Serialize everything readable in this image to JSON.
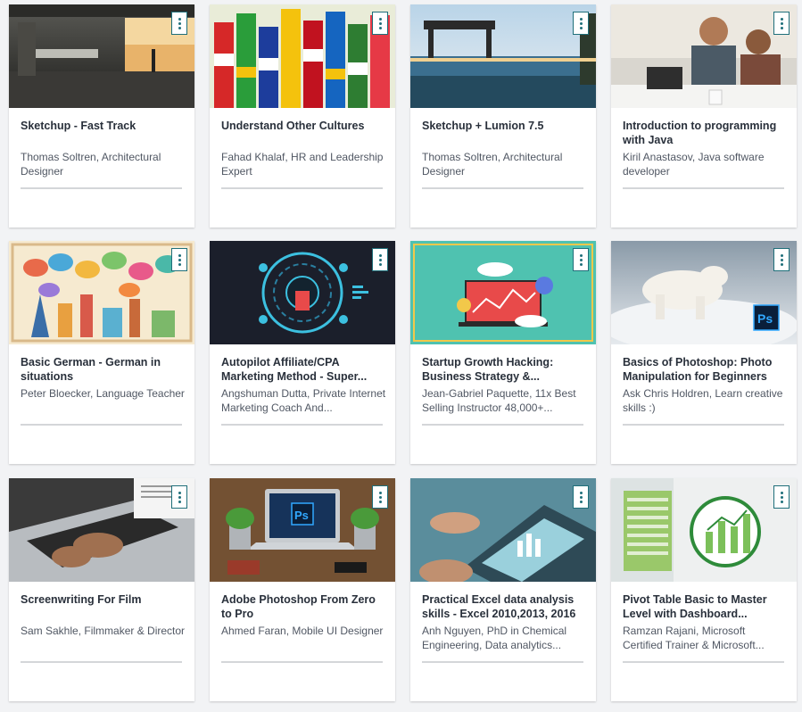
{
  "courses": [
    {
      "title": "Sketchup - Fast Track",
      "author": "Thomas Soltren, Architectural Designer",
      "image": "dark-interior",
      "progress": 0
    },
    {
      "title": "Understand Other Cultures",
      "author": "Fahad Khalaf, HR and Leadership Expert",
      "image": "flag-people",
      "progress": 0
    },
    {
      "title": "Sketchup + Lumion 7.5",
      "author": "Thomas Soltren, Architectural Designer",
      "image": "pool-villa",
      "progress": 0
    },
    {
      "title": "Introduction to programming with Java",
      "author": "Kiril Anastasov, Java software developer",
      "image": "office-people",
      "progress": 0
    },
    {
      "title": "Basic German - German in situations",
      "author": "Peter Bloecker, Language Teacher",
      "image": "landmarks-speech",
      "progress": 0
    },
    {
      "title": "Autopilot Affiliate/CPA Marketing Method - Super...",
      "author": "Angshuman Dutta, Private Internet Marketing Coach And...",
      "image": "tech-circle",
      "progress": 0
    },
    {
      "title": "Startup Growth Hacking: Business Strategy &...",
      "author": "Jean-Gabriel Paquette, 11x Best Selling Instructor 48,000+...",
      "image": "teal-laptop",
      "progress": 0
    },
    {
      "title": "Basics of Photoshop: Photo Manipulation for Beginners",
      "author": "Ask Chris Holdren, Learn creative skills :)",
      "image": "polar-bear",
      "progress": 0
    },
    {
      "title": "Screenwriting For Film",
      "author": "Sam Sakhle, Filmmaker & Director",
      "image": "typing-laptop",
      "progress": 0
    },
    {
      "title": "Adobe Photoshop From Zero to Pro",
      "author": "Ahmed Faran, Mobile UI Designer",
      "image": "desk-photoshop",
      "progress": 0
    },
    {
      "title": "Practical Excel data analysis skills - Excel 2010,2013, 2016",
      "author": "Anh Nguyen, PhD in Chemical Engineering, Data analytics...",
      "image": "tablet-hands",
      "progress": 0
    },
    {
      "title": "Pivot Table Basic to Master Level with Dashboard...",
      "author": "Ramzan Rajani, Microsoft Certified Trainer & Microsoft...",
      "image": "excel-chart",
      "progress": 0
    }
  ],
  "colors": {
    "accent": "#1f6f7a",
    "title": "#29303b",
    "author": "#505763",
    "background": "#f2f3f5"
  },
  "icons": {
    "menu": "more-vertical-icon"
  }
}
